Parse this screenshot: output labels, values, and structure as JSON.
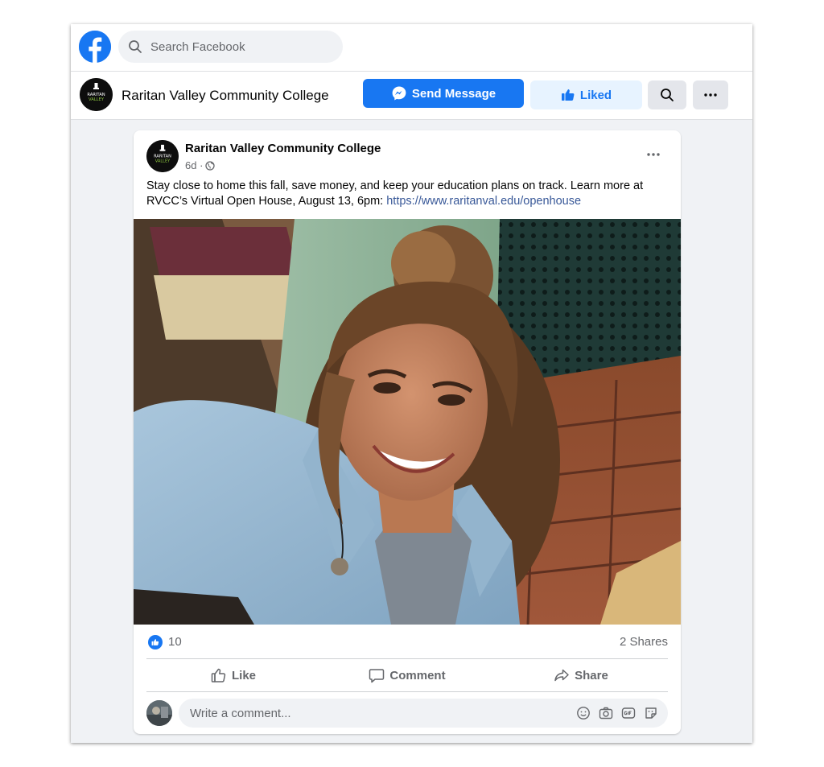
{
  "topbar": {
    "logo_icon": "facebook-logo-icon",
    "search_placeholder": "Search Facebook"
  },
  "page": {
    "name": "Raritan Valley Community College",
    "logo_text": [
      "RARITAN",
      "VALLEY"
    ],
    "send_message_label": "Send Message",
    "liked_label": "Liked"
  },
  "post": {
    "author": "Raritan Valley Community College",
    "time": "6d ·",
    "privacy_icon": "globe-icon",
    "text": "Stay close to home this fall, save money, and keep your education plans on track. Learn more at RVCC’s Virtual Open House, August 13, 6pm: ",
    "link": "https://www.raritanval.edu/openhouse",
    "photo_description": "Smiling young woman with curly hair in a top bun wearing a light denim shirt",
    "likes_count": "10",
    "shares": "2 Shares",
    "actions": {
      "like": "Like",
      "comment": "Comment",
      "share": "Share"
    },
    "comment_placeholder": "Write a comment..."
  },
  "colors": {
    "brand_blue": "#1877f2",
    "liked_bg": "#e7f3ff",
    "page_bg": "#f0f2f5",
    "link": "#385898"
  }
}
